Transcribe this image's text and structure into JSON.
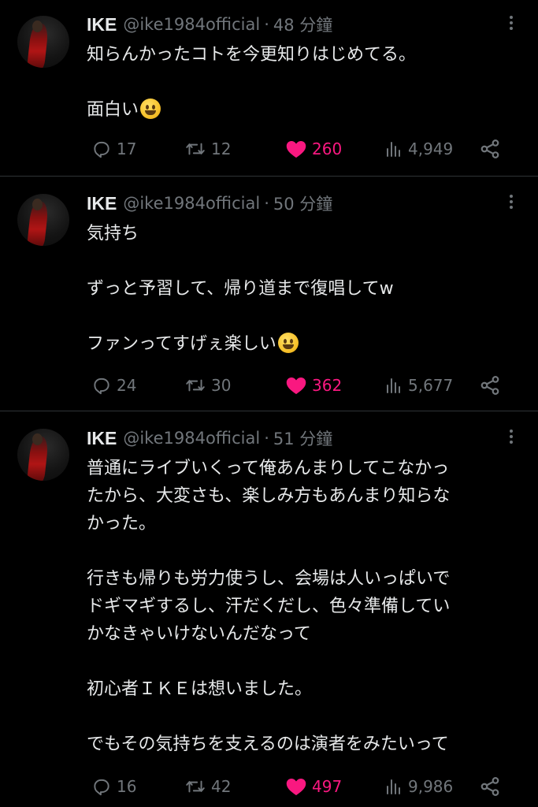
{
  "tweets": [
    {
      "name": "IKE",
      "handle": "@ike1984official",
      "separator": "·",
      "time": "48 分鐘",
      "lines": [
        "知らんかったコトを今更知りはじめてる。",
        "",
        "面白い"
      ],
      "emoji_after_line": 2,
      "emoji": "rolling-on-floor-laughing-emoji",
      "replies": "17",
      "retweets": "12",
      "likes": "260",
      "views": "4,949"
    },
    {
      "name": "IKE",
      "handle": "@ike1984official",
      "separator": "·",
      "time": "50 分鐘",
      "lines": [
        "気持ち",
        "",
        "ずっと予習して、帰り道まで復唱してw",
        "",
        "ファンってすげぇ楽しい"
      ],
      "emoji_after_line": 4,
      "emoji": "grinning-face-emoji",
      "replies": "24",
      "retweets": "30",
      "likes": "362",
      "views": "5,677"
    },
    {
      "name": "IKE",
      "handle": "@ike1984official",
      "separator": "·",
      "time": "51 分鐘",
      "lines": [
        "普通にライブいくって俺あんまりしてこなかっ",
        "たから、大変さも、楽しみ方もあんまり知らな",
        "かった。",
        "",
        "行きも帰りも労力使うし、会場は人いっぱいで",
        "ドギマギするし、汗だくだし、色々準備してい",
        "かなきゃいけないんだなって",
        "",
        "初心者ＩＫＥは想いました。",
        "",
        "でもその気持ちを支えるのは演者をみたいって"
      ],
      "replies": "16",
      "retweets": "42",
      "likes": "497",
      "views": "9,986"
    }
  ],
  "colors": {
    "background": "#000000",
    "text": "#e7e9ea",
    "muted": "#71767b",
    "like": "#f91880",
    "divider": "#2f3336"
  }
}
